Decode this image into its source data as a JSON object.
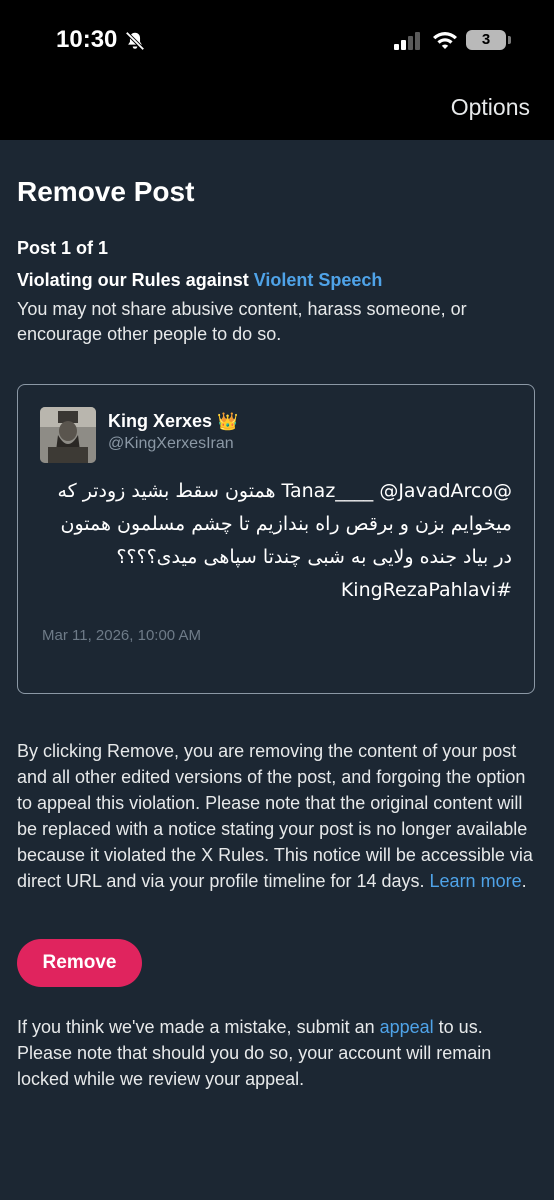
{
  "status_bar": {
    "time": "10:30",
    "battery": "3",
    "icons": [
      "bell-slash-icon",
      "cellular-signal-icon",
      "wifi-icon",
      "battery-icon"
    ]
  },
  "header": {
    "options_label": "Options"
  },
  "page": {
    "title": "Remove Post",
    "post_count": "Post 1 of 1",
    "violation_prefix": "Violating our Rules against ",
    "violation_link": "Violent Speech",
    "violation_description": "You may not share abusive content, harass someone, or encourage other people to do so."
  },
  "tweet": {
    "author_name": "King Xerxes",
    "author_badge": "👑",
    "author_handle": "@KingXerxesIran",
    "text": "@Tanaz____ @JavadArco همتون سقط بشید زودتر که میخوایم بزن و برقص راه بندازیم تا چشم مسلمون همتون در بیاد جنده ولایی به شبی چندتا سپاهی میدی؟؟؟؟ #KingRezaPahlavi",
    "date": "Mar 11, 2026, 10:00 AM"
  },
  "notice": {
    "text": "By clicking Remove, you are removing the content of your post and all other edited versions of the post, and forgoing the option to appeal this violation. Please note that the original content will be replaced with a notice stating your post is no longer available because it violated the X Rules. This notice will be accessible via direct URL and via your profile timeline for 14 days. ",
    "learn_more": "Learn more",
    "period": "."
  },
  "actions": {
    "remove_label": "Remove"
  },
  "appeal": {
    "prefix": "If you think we've made a mistake, submit an ",
    "link": "appeal",
    "suffix": " to us. Please note that should you do so, your account will remain locked while we review your appeal."
  },
  "colors": {
    "background": "#1c2733",
    "link": "#4fa3e8",
    "remove_button": "#e0245e"
  }
}
